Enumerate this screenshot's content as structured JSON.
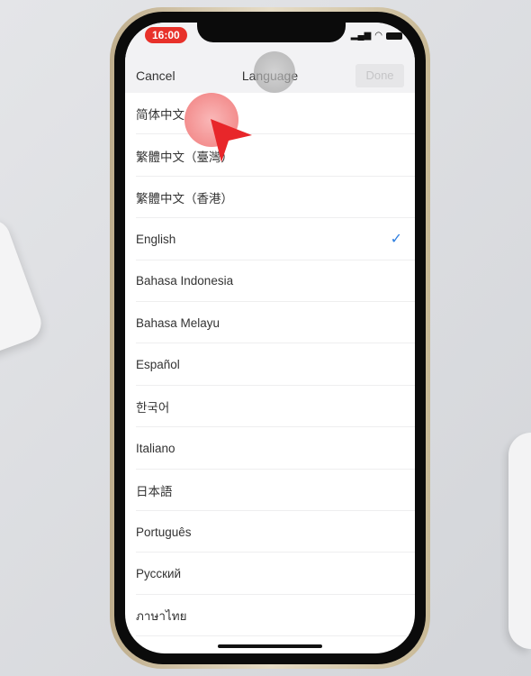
{
  "status": {
    "time": "16:00"
  },
  "nav": {
    "cancel": "Cancel",
    "title": "Language",
    "done": "Done"
  },
  "languages": [
    {
      "label": "简体中文"
    },
    {
      "label": "繁體中文（臺灣）"
    },
    {
      "label": "繁體中文（香港）"
    },
    {
      "label": "English",
      "selected": true
    },
    {
      "label": "Bahasa Indonesia"
    },
    {
      "label": "Bahasa Melayu"
    },
    {
      "label": "Español"
    },
    {
      "label": "한국어"
    },
    {
      "label": "Italiano"
    },
    {
      "label": "日本語"
    },
    {
      "label": "Português"
    },
    {
      "label": "Русский"
    },
    {
      "label": "ภาษาไทย"
    }
  ],
  "colors": {
    "accent": "#2f7fe0",
    "time_badge": "#e8312a"
  }
}
